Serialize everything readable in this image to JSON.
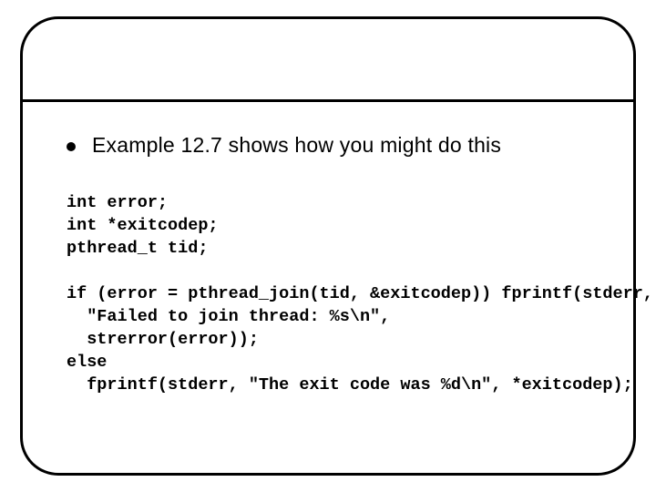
{
  "bullet": "Example 12.7 shows how you might do this",
  "code": {
    "l1": "int error;",
    "l2": "int *exitcodep;",
    "l3": "pthread_t tid;",
    "l4": "",
    "l5": "if (error = pthread_join(tid, &exitcodep)) fprintf(stderr,",
    "l6": "  \"Failed to join thread: %s\\n\",",
    "l7": "  strerror(error));",
    "l8": "else",
    "l9": "  fprintf(stderr, \"The exit code was %d\\n\", *exitcodep);"
  }
}
